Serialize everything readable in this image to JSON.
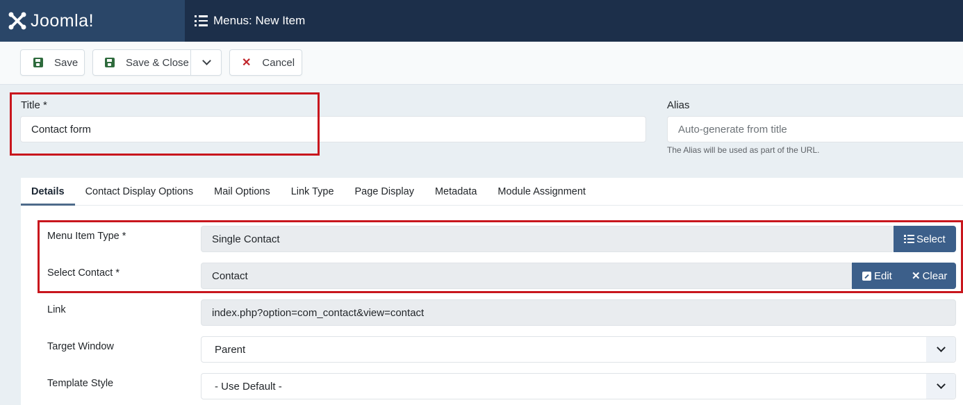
{
  "header": {
    "brand": "Joomla!",
    "page_title": "Menus: New Item"
  },
  "toolbar": {
    "save_label": "Save",
    "save_close_label": "Save & Close",
    "cancel_label": "Cancel"
  },
  "title_field": {
    "label": "Title *",
    "value": "Contact form"
  },
  "alias_field": {
    "label": "Alias",
    "placeholder": "Auto-generate from title",
    "help": "The Alias will be used as part of the URL."
  },
  "tabs": [
    {
      "label": "Details",
      "active": true
    },
    {
      "label": "Contact Display Options",
      "active": false
    },
    {
      "label": "Mail Options",
      "active": false
    },
    {
      "label": "Link Type",
      "active": false
    },
    {
      "label": "Page Display",
      "active": false
    },
    {
      "label": "Metadata",
      "active": false
    },
    {
      "label": "Module Assignment",
      "active": false
    }
  ],
  "details": {
    "menu_item_type": {
      "label": "Menu Item Type *",
      "value": "Single Contact",
      "select_label": "Select"
    },
    "select_contact": {
      "label": "Select Contact *",
      "value": "Contact",
      "edit_label": "Edit",
      "clear_label": "Clear"
    },
    "link": {
      "label": "Link",
      "value": "index.php?option=com_contact&view=contact"
    },
    "target_window": {
      "label": "Target Window",
      "value": "Parent"
    },
    "template_style": {
      "label": "Template Style",
      "value": "- Use Default -"
    }
  },
  "colors": {
    "header_bg": "#1c2f4a",
    "brand_bg": "#2a4668",
    "primary_button": "#3c5f8a",
    "highlight_border": "#c8161d",
    "save_icon": "#2f6b3d",
    "cancel_icon": "#c0242a"
  }
}
